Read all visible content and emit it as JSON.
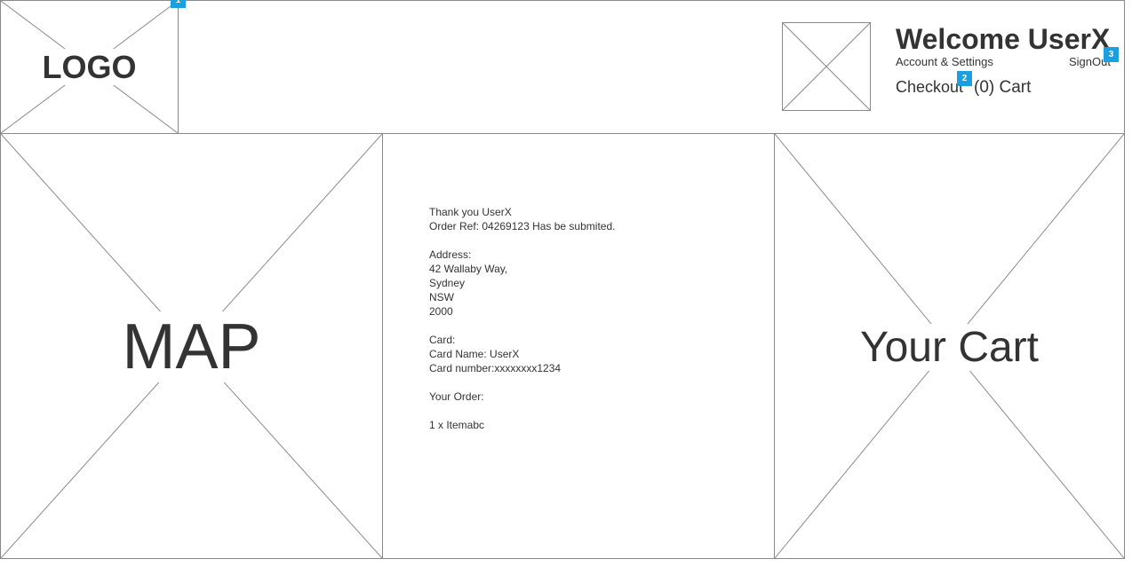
{
  "header": {
    "logo_label": "LOGO",
    "welcome": "Welcome UserX",
    "account_settings": "Account & Settings",
    "sign_out": "SignOut",
    "checkout": "Checkout",
    "cart_count": "(0) Cart"
  },
  "badges": [
    "1",
    "2",
    "3"
  ],
  "map": {
    "label": "MAP"
  },
  "order": {
    "lines": [
      "Thank you UserX",
      "Order Ref: 04269123 Has be submited.",
      "",
      "Address:",
      "42 Wallaby Way,",
      "Sydney",
      "NSW",
      "2000",
      "",
      "Card:",
      "Card Name: UserX",
      "Card number:xxxxxxxx1234",
      "",
      "Your Order:",
      "",
      "1 x Itemabc"
    ]
  },
  "cart": {
    "label": "Your Cart"
  },
  "colors": {
    "border": "#8a8a8a",
    "text": "#333333",
    "badge": "#1a9fe0"
  }
}
